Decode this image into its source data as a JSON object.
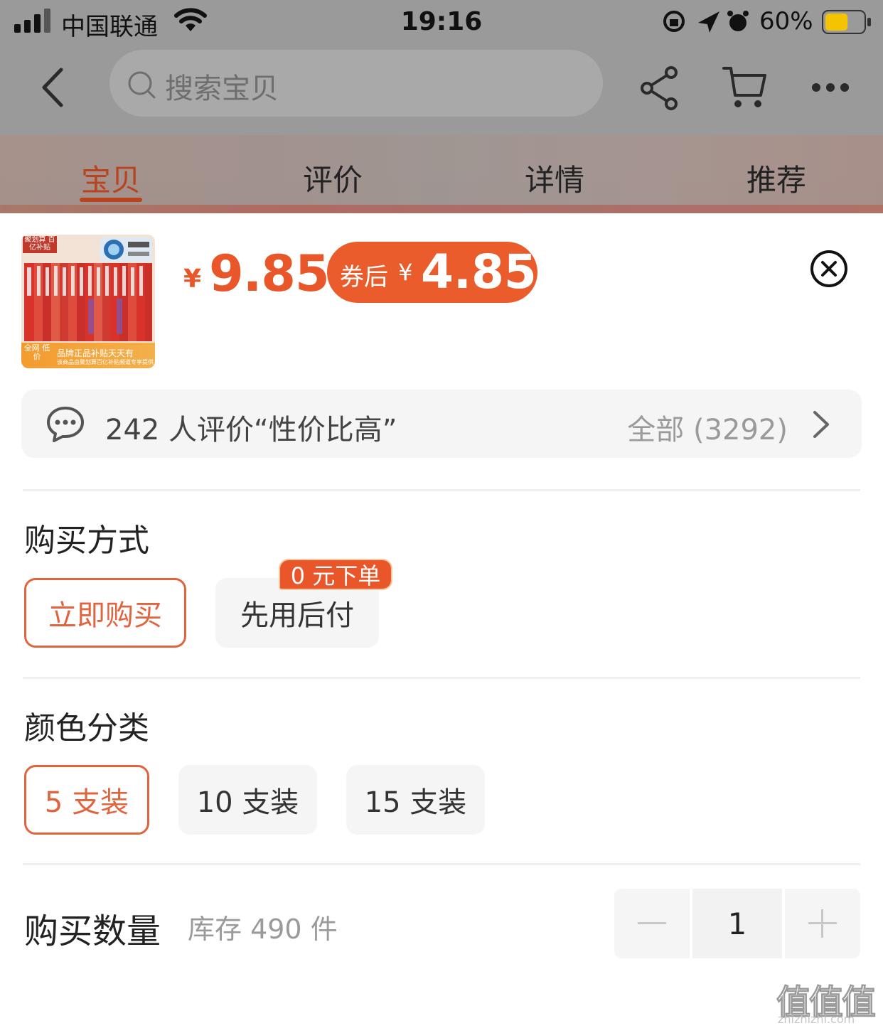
{
  "status_bar": {
    "carrier": "中国联通",
    "time": "19:16",
    "battery_percent": "60%",
    "battery_level": 0.6
  },
  "nav": {
    "search_placeholder": "搜索宝贝",
    "icons": [
      "back-icon",
      "share-icon",
      "cart-icon",
      "more-icon"
    ]
  },
  "tabs": [
    {
      "label": "宝贝",
      "active": true
    },
    {
      "label": "评价",
      "active": false
    },
    {
      "label": "详情",
      "active": false
    },
    {
      "label": "推荐",
      "active": false
    }
  ],
  "product": {
    "thumb": {
      "top_label": "聚划算 百亿补贴",
      "bottom_left": "全网 低价",
      "bottom_text": "品牌正品补贴天天有",
      "bottom_sub": "该商品由聚划算百亿补贴频道专享提供"
    },
    "currency": "¥",
    "price": "9.85",
    "coupon_prefix": "券后",
    "coupon_currency": "¥",
    "coupon_price": "4.85"
  },
  "review": {
    "text": "242 人评价“性价比高”",
    "all": "全部 (3292)"
  },
  "purchase_method": {
    "title": "购买方式",
    "options": [
      {
        "label": "立即购买",
        "selected": true
      },
      {
        "label": "先用后付",
        "selected": false
      }
    ],
    "badge": "0 元下单"
  },
  "color_category": {
    "title": "颜色分类",
    "options": [
      {
        "label": "5 支装",
        "selected": true
      },
      {
        "label": "10 支装",
        "selected": false
      },
      {
        "label": "15 支装",
        "selected": false
      }
    ]
  },
  "quantity": {
    "title": "购买数量",
    "stock": "库存 490 件",
    "value": "1"
  },
  "watermark": {
    "main": "值值值",
    "url": "zhizhizhi.com"
  },
  "colors": {
    "accent": "#e8562a",
    "selected_border": "#e0653f",
    "tab_active": "#b8431c",
    "option_bg": "#f5f5f5"
  }
}
